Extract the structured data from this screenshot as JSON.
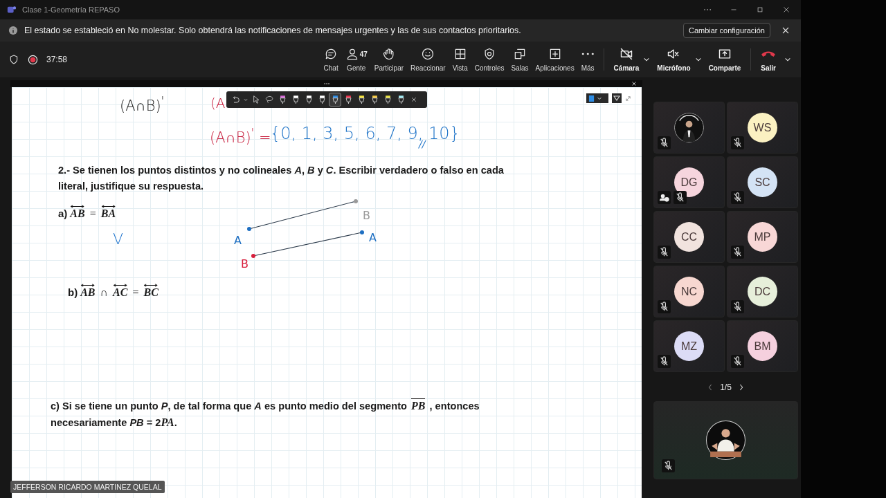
{
  "window": {
    "title": "Clase 1-Geometría REPASO"
  },
  "notification": {
    "text": "El estado se estableció en No molestar. Solo obtendrá las notificaciones de mensajes urgentes y las de sus contactos prioritarios.",
    "button": "Cambiar configuración"
  },
  "meeting_bar": {
    "recording": true,
    "timer": "37:58",
    "actions": [
      {
        "kind": "chat",
        "label": "Chat"
      },
      {
        "kind": "people",
        "label": "Gente",
        "badge": "47"
      },
      {
        "kind": "hand",
        "label": "Participar"
      },
      {
        "kind": "react",
        "label": "Reaccionar"
      },
      {
        "kind": "view",
        "label": "Vista"
      },
      {
        "kind": "controls",
        "label": "Controles"
      },
      {
        "kind": "rooms",
        "label": "Salas"
      },
      {
        "kind": "apps",
        "label": "Aplicaciones"
      },
      {
        "kind": "more",
        "label": "Más"
      }
    ],
    "devices": [
      {
        "kind": "camera",
        "label": "Cámara",
        "off": true
      },
      {
        "kind": "mic",
        "label": "Micrófono",
        "off": true
      },
      {
        "kind": "share",
        "label": "Comparte"
      }
    ],
    "leave": {
      "label": "Salir"
    }
  },
  "whiteboard": {
    "ink_toolbar": {
      "pens": [
        {
          "color": "#d66ad8",
          "selected": false
        },
        {
          "color": "#ffffff",
          "selected": false
        },
        {
          "color": "#ffffff",
          "selected": false
        },
        {
          "color": "#ffffff",
          "selected": false
        },
        {
          "color": "#2f8de4",
          "selected": true
        },
        {
          "color": "#e8344e",
          "selected": false
        },
        {
          "color": "#f5e23a",
          "selected": false
        },
        {
          "color": "#f5c842",
          "selected": false
        },
        {
          "color": "#e8e040",
          "selected": false
        },
        {
          "color": "#9ee8f0",
          "selected": false
        }
      ]
    },
    "note_top": "(A∩B)$^{'}$",
    "note_covered": "(A",
    "result_lhs": "(A∩B)$^{'}$ =",
    "result_set": "{0, 1, 3, 5, 6, 7, 9, 10}",
    "result_mark": "//",
    "problem": "2.- Se tienen los puntos distintos y no colineales *A*, *B* y *C*. Escribir verdadero o falso en cada literal, justifique su respuesta.",
    "item_a": {
      "label": "a)",
      "terms": [
        {
          "kind": "vec",
          "text": "AB"
        },
        {
          "kind": "op",
          "text": "="
        },
        {
          "kind": "vec",
          "text": "BA"
        }
      ]
    },
    "answer_a": "V",
    "drawing": {
      "segments": [
        {
          "start": {
            "label": "A",
            "color": "#1e6fc2"
          },
          "end": {
            "label": "B",
            "color": "#9a9a9a"
          }
        },
        {
          "start": {
            "label": "B",
            "color": "#d81e3c"
          },
          "end": {
            "label": "A",
            "color": "#1e6fc2"
          }
        }
      ]
    },
    "item_b": {
      "label": "b)",
      "terms": [
        {
          "kind": "vec",
          "text": "AB"
        },
        {
          "kind": "op",
          "text": "∩"
        },
        {
          "kind": "vec",
          "text": "AC"
        },
        {
          "kind": "op",
          "text": "="
        },
        {
          "kind": "vec",
          "text": "BC"
        }
      ]
    },
    "item_c": [
      {
        "kind": "text",
        "text": "c) Si se tiene un punto *P*, de tal forma que *A* es punto medio del segmento "
      },
      {
        "kind": "seg",
        "text": "PB"
      },
      {
        "kind": "text",
        "text": " , entonces necesariamente *PB* = 2"
      },
      {
        "kind": "math",
        "text": "PA"
      },
      {
        "kind": "text",
        "text": "."
      }
    ]
  },
  "presenter_name": "JEFFERSON RICARDO MARTINEZ QUELAL",
  "participants": [
    {
      "kind": "picture",
      "muted": true,
      "unverified": false
    },
    {
      "kind": "initials",
      "initials": "WS",
      "color": "#fbf1c2",
      "muted": true,
      "unverified": false
    },
    {
      "kind": "initials",
      "initials": "DG",
      "color": "#f6d5dd",
      "muted": true,
      "unverified": true
    },
    {
      "kind": "initials",
      "initials": "SC",
      "color": "#d4e3f5",
      "muted": true,
      "unverified": false
    },
    {
      "kind": "initials",
      "initials": "CC",
      "color": "#f1e3de",
      "muted": true,
      "unverified": false
    },
    {
      "kind": "initials",
      "initials": "MP",
      "color": "#f8d7d6",
      "muted": true,
      "unverified": false
    },
    {
      "kind": "initials",
      "initials": "NC",
      "color": "#f7d7d0",
      "muted": true,
      "unverified": false
    },
    {
      "kind": "initials",
      "initials": "DC",
      "color": "#e6efda",
      "muted": true,
      "unverified": false
    },
    {
      "kind": "initials",
      "initials": "MZ",
      "color": "#dcdcf6",
      "muted": true,
      "unverified": false
    },
    {
      "kind": "initials",
      "initials": "BM",
      "color": "#f5d0de",
      "muted": true,
      "unverified": false
    }
  ],
  "pager": "1/5",
  "self_tile": {
    "kind": "picture",
    "muted": true
  }
}
